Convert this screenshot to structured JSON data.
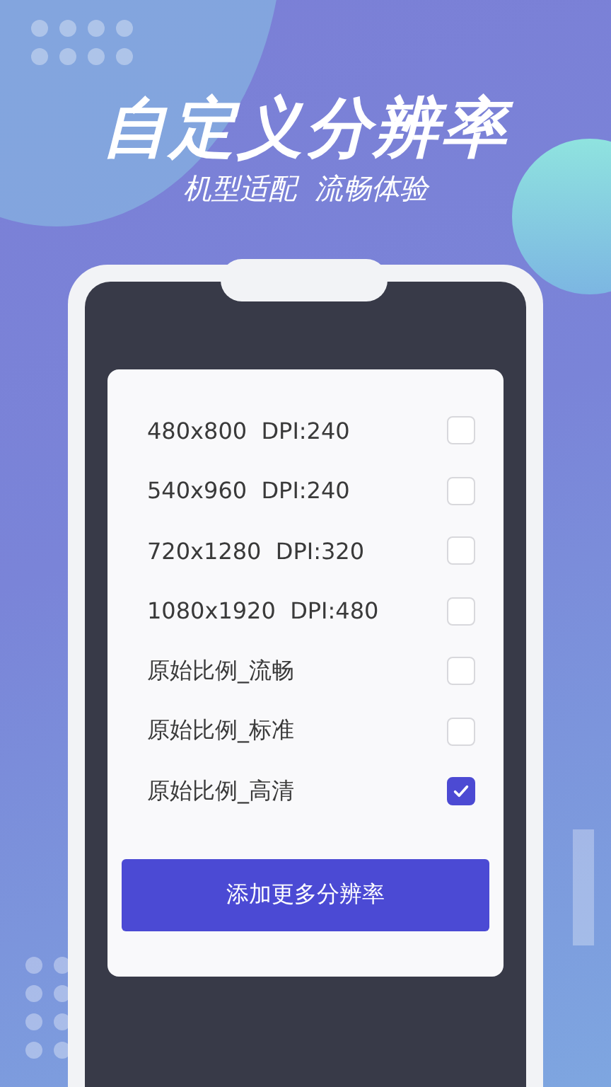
{
  "headline": "自定义分辨率",
  "subtitle": "机型适配  流畅体验",
  "options": [
    {
      "label": "480x800  DPI:240",
      "checked": false
    },
    {
      "label": "540x960  DPI:240",
      "checked": false
    },
    {
      "label": "720x1280  DPI:320",
      "checked": false
    },
    {
      "label": "1080x1920  DPI:480",
      "checked": false
    },
    {
      "label": "原始比例_流畅",
      "checked": false
    },
    {
      "label": "原始比例_标准",
      "checked": false
    },
    {
      "label": "原始比例_高清",
      "checked": true
    }
  ],
  "add_button": "添加更多分辨率"
}
